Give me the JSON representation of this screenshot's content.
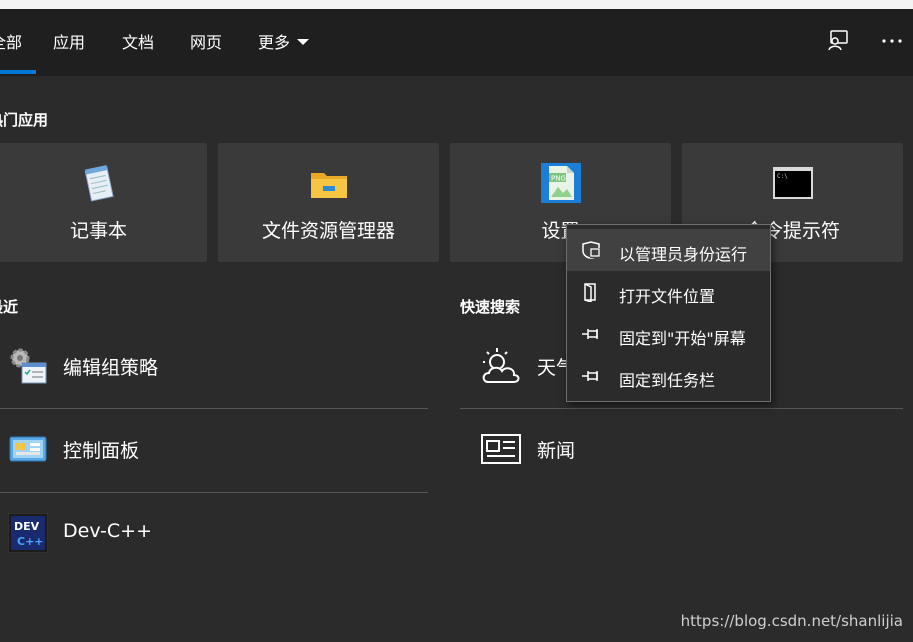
{
  "tabs": [
    {
      "label": "全部",
      "active": true
    },
    {
      "label": "应用"
    },
    {
      "label": "文档"
    },
    {
      "label": "网页"
    },
    {
      "label": "更多"
    }
  ],
  "header_icons": [
    "feedback-icon",
    "more-options-icon"
  ],
  "top_apps": {
    "title": "热门应用",
    "items": [
      {
        "label": "记事本",
        "icon": "notepad-icon"
      },
      {
        "label": "文件资源管理器",
        "icon": "file-explorer-icon"
      },
      {
        "label": "设置",
        "icon": "png-file-icon"
      },
      {
        "label": "命令提示符",
        "icon": "command-prompt-icon"
      }
    ]
  },
  "recent": {
    "title": "最近",
    "items": [
      {
        "label": "编辑组策略",
        "icon": "group-policy-icon"
      },
      {
        "label": "控制面板",
        "icon": "control-panel-icon"
      },
      {
        "label": "Dev-C++",
        "icon": "dev-cpp-icon"
      }
    ]
  },
  "quick_search": {
    "title": "快速搜索",
    "items": [
      {
        "label": "天气",
        "icon": "weather-icon"
      },
      {
        "label": "新闻",
        "icon": "news-icon"
      }
    ]
  },
  "context_menu": {
    "items": [
      {
        "label": "以管理员身份运行",
        "icon": "shield-icon",
        "highlighted": true
      },
      {
        "label": "打开文件位置",
        "icon": "open-location-icon"
      },
      {
        "label": "固定到\"开始\"屏幕",
        "icon": "pin-icon"
      },
      {
        "label": "固定到任务栏",
        "icon": "pin-icon"
      }
    ]
  },
  "watermark": "https://blog.csdn.net/shanlijia"
}
